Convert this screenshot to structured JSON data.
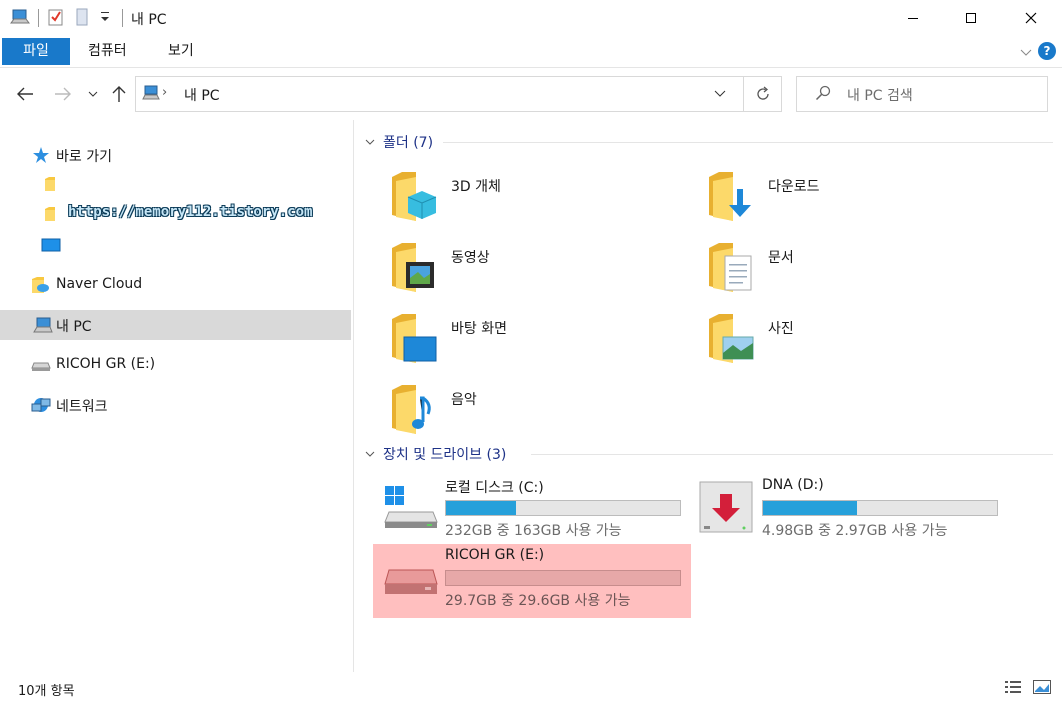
{
  "window": {
    "title": "내 PC",
    "minimize_label": "minimize",
    "maximize_label": "maximize",
    "close_label": "close"
  },
  "ribbon": {
    "tabs": [
      "파일",
      "컴퓨터",
      "보기"
    ],
    "help": "?"
  },
  "address": {
    "path": "내 PC",
    "separator": "›"
  },
  "search": {
    "placeholder": "내 PC 검색"
  },
  "nav": {
    "quick_access": "바로 가기",
    "naver_cloud": "Naver Cloud",
    "this_pc": "내 PC",
    "ricoh": "RICOH GR (E:)",
    "network": "네트워크"
  },
  "watermark": "https://memory112.tistory.com",
  "folders": {
    "heading": "폴더 (7)",
    "items": [
      {
        "label": "3D 개체",
        "icon": "3d-objects-folder-icon"
      },
      {
        "label": "다운로드",
        "icon": "downloads-folder-icon"
      },
      {
        "label": "동영상",
        "icon": "videos-folder-icon"
      },
      {
        "label": "문서",
        "icon": "documents-folder-icon"
      },
      {
        "label": "바탕 화면",
        "icon": "desktop-folder-icon"
      },
      {
        "label": "사진",
        "icon": "pictures-folder-icon"
      },
      {
        "label": "음악",
        "icon": "music-folder-icon"
      }
    ]
  },
  "devices": {
    "heading": "장치 및 드라이브 (3)",
    "items": [
      {
        "name": "로컬 디스크 (C:)",
        "free": "232GB 중 163GB 사용 가능",
        "used_fraction": 0.3
      },
      {
        "name": "DNA (D:)",
        "free": "4.98GB 중 2.97GB 사용 가능",
        "used_fraction": 0.4
      },
      {
        "name": "RICOH GR (E:)",
        "free": "29.7GB 중 29.6GB 사용 가능",
        "used_fraction": 0.0
      }
    ]
  },
  "status": {
    "count": "10개 항목"
  },
  "colors": {
    "accent": "#1979ca",
    "bar_fill": "#26a0da",
    "highlight": "#ffbfbf",
    "selected": "#d9d9d9"
  }
}
